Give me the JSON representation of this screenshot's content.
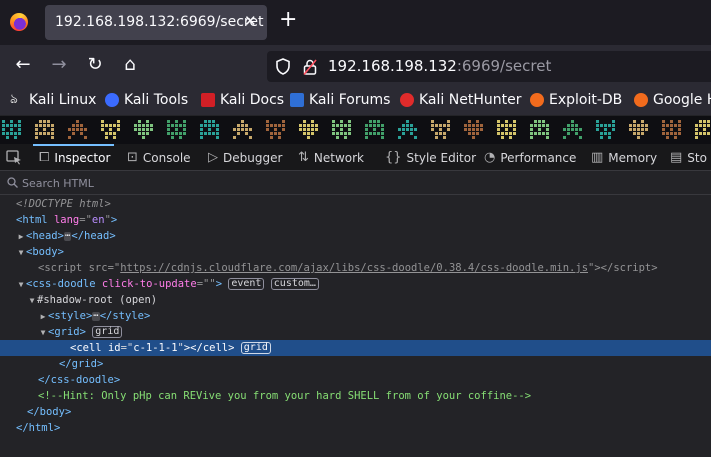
{
  "tab": {
    "title": "192.168.198.132:6969/secret",
    "close_glyph": "✕"
  },
  "newtab_glyph": "+",
  "nav": {
    "back": "←",
    "forward": "→",
    "reload": "↻",
    "home": "⌂"
  },
  "url": {
    "host": "192.168.198.132",
    "rest": ":6969/secret"
  },
  "bookmarks": [
    {
      "label": "Kali Linux",
      "icon": "kali-dragon-icon",
      "color": "#e6e6e6"
    },
    {
      "label": "Kali Tools",
      "icon": "kali-tools-icon",
      "color": "#3b6bff"
    },
    {
      "label": "Kali Docs",
      "icon": "kali-docs-icon",
      "color": "#d21f26"
    },
    {
      "label": "Kali Forums",
      "icon": "kali-forums-icon",
      "color": "#2f6fd6"
    },
    {
      "label": "Kali NetHunter",
      "icon": "nethunter-icon",
      "color": "#e02b2b"
    },
    {
      "label": "Exploit-DB",
      "icon": "exploitdb-icon",
      "color": "#f26b1d"
    },
    {
      "label": "Google H",
      "icon": "google-hacking-icon",
      "color": "#f26b1d"
    }
  ],
  "devtools": {
    "tabs": [
      {
        "label": "Inspector",
        "icon": "inspector-icon"
      },
      {
        "label": "Console",
        "icon": "console-icon"
      },
      {
        "label": "Debugger",
        "icon": "debugger-icon"
      },
      {
        "label": "Network",
        "icon": "network-icon"
      },
      {
        "label": "Style Editor",
        "icon": "style-editor-icon"
      },
      {
        "label": "Performance",
        "icon": "performance-icon"
      },
      {
        "label": "Memory",
        "icon": "memory-icon"
      },
      {
        "label": "Sto",
        "icon": "storage-icon"
      }
    ],
    "search_placeholder": "Search HTML"
  },
  "doodle_colors": [
    "#2aa198",
    "#c7a86b",
    "#a0643c",
    "#d4c46a",
    "#7fc47f",
    "#42a06a"
  ],
  "markup": {
    "doctype": "<!DOCTYPE html>",
    "html_tag": "html",
    "html_lang_attr": "lang",
    "html_lang_val": "en",
    "head_tag": "head",
    "body_tag": "body",
    "script_tag": "script",
    "script_src_attr": "src",
    "script_src": "https://cdnjs.cloudflare.com/ajax/libs/css-doodle/0.38.4/css-doodle.min.js",
    "doodle_tag": "css-doodle",
    "doodle_attr": "click-to-update",
    "doodle_attr_val": "",
    "badge_event": "event",
    "badge_custom": "custom…",
    "shadow_root": "#shadow-root (open)",
    "style_tag": "style",
    "grid_tag": "grid",
    "badge_grid": "grid",
    "cell_tag": "cell",
    "cell_id_attr": "id",
    "cell_id_val": "c-1-1-1",
    "comment": "<!--Hint: Only pHp can REVive you from your hard SHELL from of your coffine-->",
    "ellipsis": "⋯"
  }
}
